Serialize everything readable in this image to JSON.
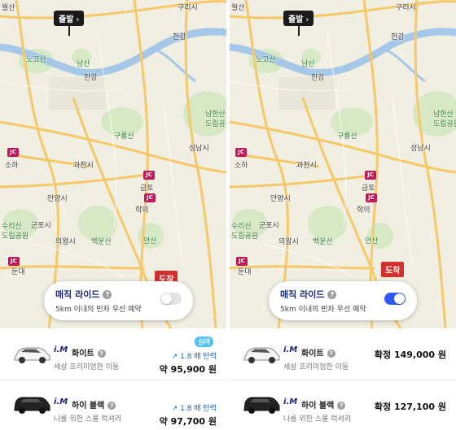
{
  "map_labels": {
    "departure": "출발",
    "arrival": "도착",
    "places": {
      "wolsan": "월산",
      "guri": "구리시",
      "hangang_n": "한강",
      "nogosan": "노고산",
      "namsan": "남산",
      "hangang_s": "한강",
      "namhansan": "남한산",
      "namhansan2": "도립공원",
      "guryongsan": "구룡산",
      "seongnam": "성남시",
      "soha": "소하",
      "gwacheon": "과천시",
      "geumto": "금토",
      "anyang": "안양시",
      "suri": "수리산",
      "suri2": "도립공원",
      "gunpo": "군포시",
      "hakui": "학의",
      "uiwang": "의왕시",
      "baegunsan": "백운산",
      "ansan": "안산",
      "dunde": "둔대",
      "jc": "JC"
    }
  },
  "magic_ride": {
    "title": "매직 라이드",
    "help": "?",
    "subtitle": "5km 이내의 빈차 우선 예약"
  },
  "left_list": [
    {
      "brand": "i.M",
      "name": "화이트",
      "desc": "세상 프리미엄한 이동",
      "badge": "심야",
      "surge": "↗ 1.8 배 탄력",
      "price": "약 95,900 원"
    },
    {
      "brand": "i.M",
      "name": "하이 블랙",
      "desc": "나를 위한 스몰 럭셔리",
      "surge": "↗ 1.8 배 탄력",
      "price": "약 97,700 원"
    }
  ],
  "right_list": [
    {
      "brand": "i.M",
      "name": "화이트",
      "desc": "세상 프리미엄한 이동",
      "price": "확정 149,000 원"
    },
    {
      "brand": "i.M",
      "name": "하이 블랙",
      "desc": "나를 위한 스몰 럭셔리",
      "price": "확정 127,100 원"
    }
  ],
  "toggle_left": "off",
  "toggle_right": "on",
  "colors": {
    "accent_blue": "#2d5bff",
    "brand_navy": "#1a237e",
    "dest_red": "#d32f2f",
    "river": "#a6c8e8",
    "road": "#f5c96a"
  }
}
